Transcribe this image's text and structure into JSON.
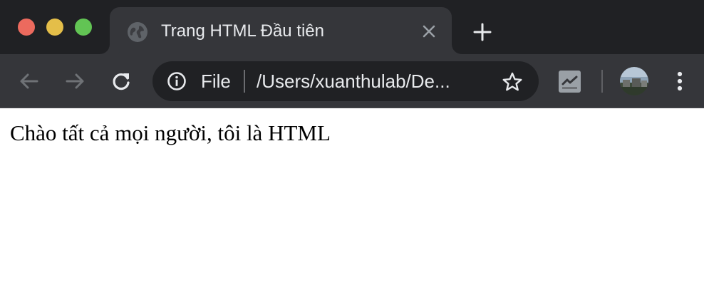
{
  "window": {
    "traffic_lights": {
      "close_color": "#ec6a5e",
      "minimize_color": "#e4be49",
      "zoom_color": "#62c454"
    }
  },
  "tab": {
    "title": "Trang HTML Đầu tiên",
    "favicon": "globe-icon",
    "close_icon": "close-icon"
  },
  "toolbar": {
    "back_icon": "arrow-left-icon",
    "forward_icon": "arrow-right-icon",
    "reload_icon": "reload-icon",
    "omnibox": {
      "info_icon": "info-icon",
      "scheme_label": "File",
      "url": "/Users/xuanthulab/De...",
      "bookmark_icon": "star-icon"
    },
    "extension_icon": "chart-check-icon",
    "profile": "avatar",
    "menu_icon": "vertical-dots-icon"
  },
  "page": {
    "body_text": "Chào tất cả mọi người, tôi là HTML"
  },
  "colors": {
    "frame": "#202124",
    "toolbar": "#35363a",
    "text_light": "#e8eaed",
    "icon_gray": "#9aa0a6"
  }
}
